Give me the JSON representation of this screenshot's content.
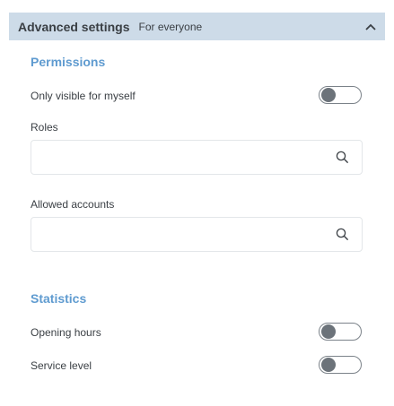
{
  "header": {
    "title": "Advanced settings",
    "subtitle": "For everyone",
    "collapse_icon": "chevron-up-icon",
    "background": "#cddbe8"
  },
  "permissions": {
    "title": "Permissions",
    "only_visible_label": "Only visible for myself",
    "only_visible_on": false,
    "roles_label": "Roles",
    "roles_value": "",
    "allowed_accounts_label": "Allowed accounts",
    "allowed_accounts_value": "",
    "search_icon": "search-icon"
  },
  "statistics": {
    "title": "Statistics",
    "opening_hours_label": "Opening hours",
    "opening_hours_on": false,
    "service_level_label": "Service level",
    "service_level_on": false
  },
  "colors": {
    "section_title": "#5f9bd0",
    "text": "#3a3f44",
    "toggle_knob": "#6c737a"
  }
}
